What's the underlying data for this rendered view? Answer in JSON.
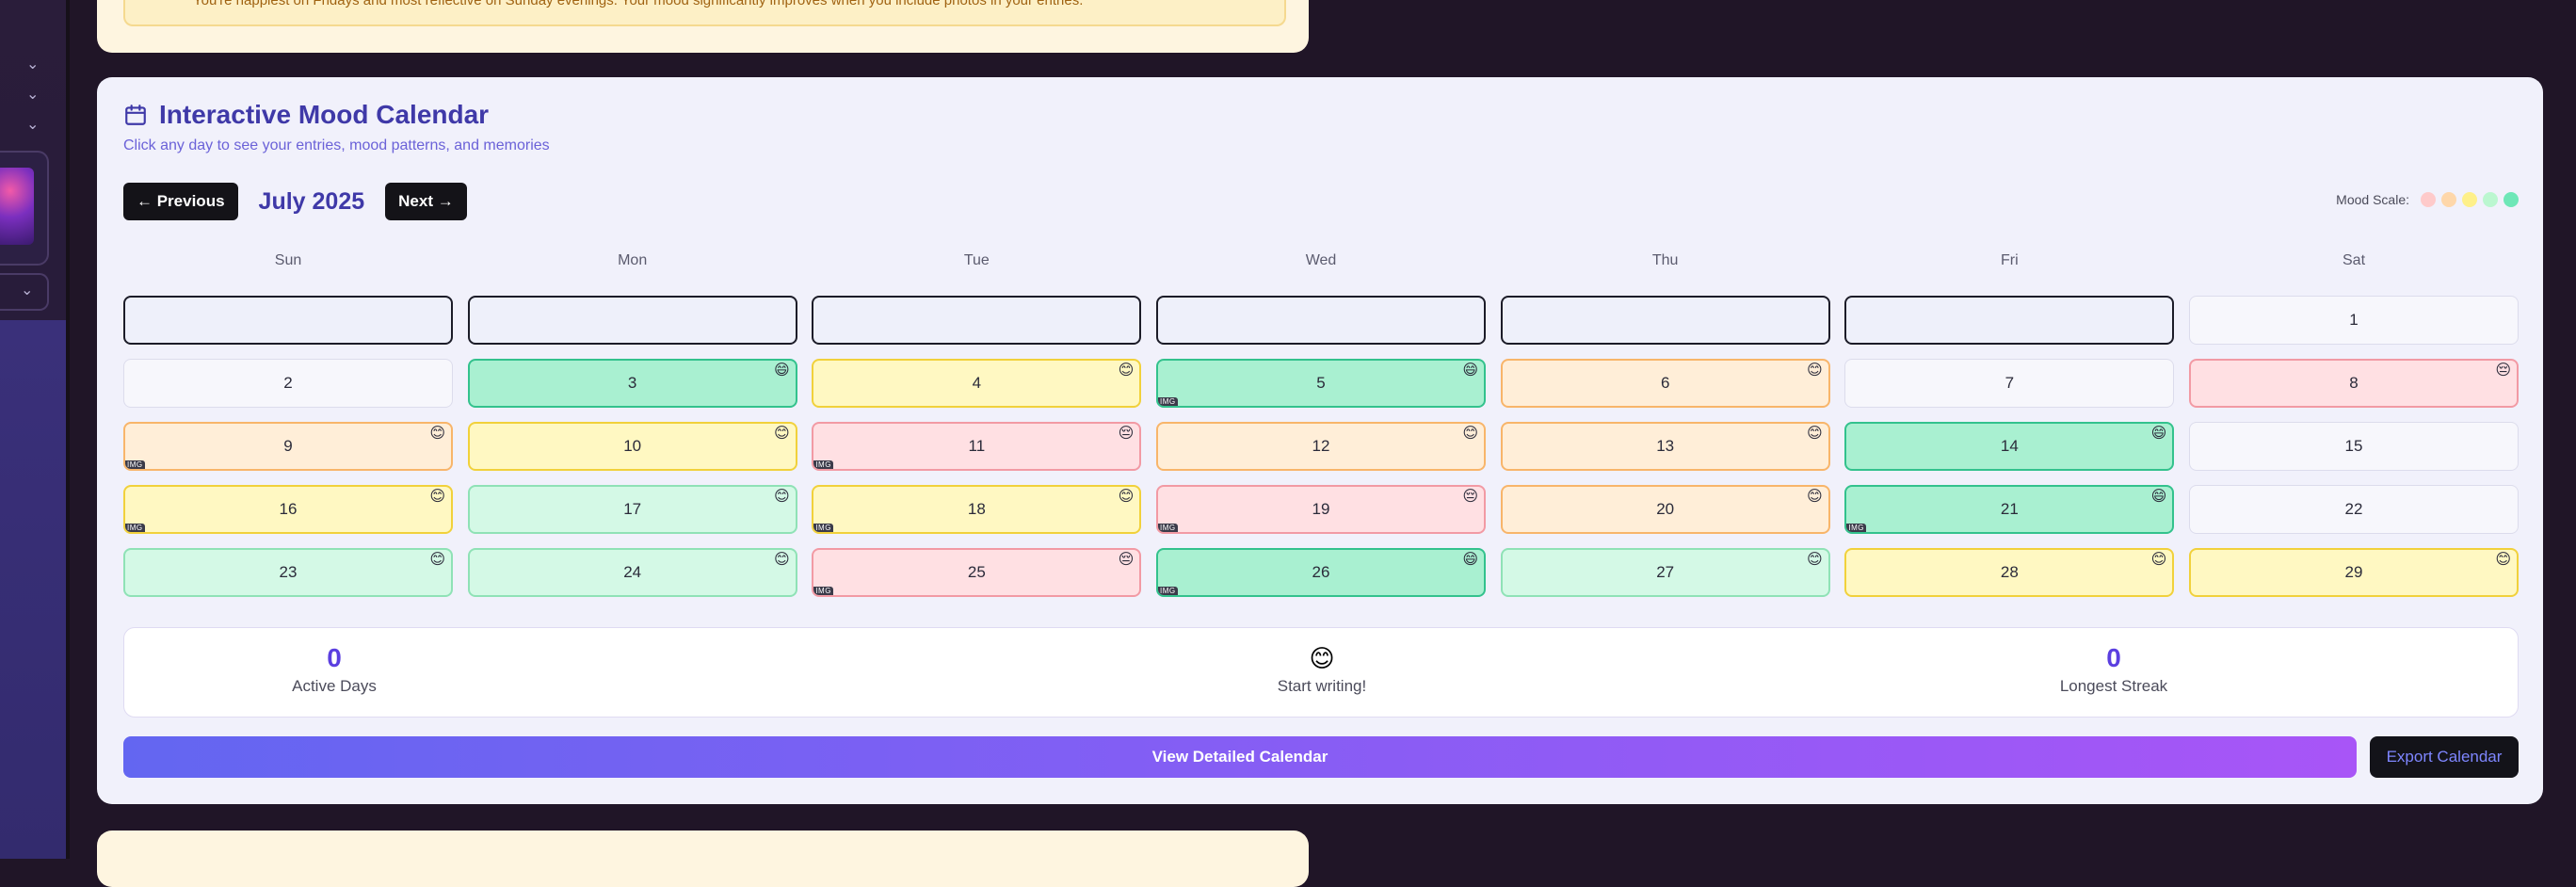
{
  "insights": {
    "text": "You're happiest on Fridays and most reflective on Sunday evenings. Your mood significantly improves when you include photos in your entries."
  },
  "calendar": {
    "title": "Interactive Mood Calendar",
    "subtitle": "Click any day to see your entries, mood patterns, and memories",
    "prev_label": "← Previous",
    "next_label": "Next →",
    "month": "July 2025",
    "mood_scale_label": "Mood Scale:",
    "mood_scale_colors": [
      "#fecaca",
      "#fed7aa",
      "#fef08a",
      "#bbf7d0",
      "#6ee7b7"
    ],
    "weekdays": [
      "Sun",
      "Mon",
      "Tue",
      "Wed",
      "Thu",
      "Fri",
      "Sat"
    ],
    "weeks": [
      [
        {
          "day": "",
          "mood": "empty"
        },
        {
          "day": "",
          "mood": "empty"
        },
        {
          "day": "",
          "mood": "empty"
        },
        {
          "day": "",
          "mood": "empty"
        },
        {
          "day": "",
          "mood": "empty"
        },
        {
          "day": "",
          "mood": "empty"
        },
        {
          "day": "1",
          "mood": "none"
        }
      ],
      [
        {
          "day": "2",
          "mood": "none"
        },
        {
          "day": "3",
          "mood": "green",
          "emoji": "😄"
        },
        {
          "day": "4",
          "mood": "yellow",
          "emoji": "😊"
        },
        {
          "day": "5",
          "mood": "green",
          "emoji": "😄",
          "tag": "IMG"
        },
        {
          "day": "6",
          "mood": "orange",
          "emoji": "😊"
        },
        {
          "day": "7",
          "mood": "none"
        },
        {
          "day": "8",
          "mood": "red",
          "emoji": "😔"
        }
      ],
      [
        {
          "day": "9",
          "mood": "orange",
          "emoji": "😊",
          "tag": "IMG"
        },
        {
          "day": "10",
          "mood": "yellow",
          "emoji": "😊"
        },
        {
          "day": "11",
          "mood": "red",
          "emoji": "😔",
          "tag": "IMG"
        },
        {
          "day": "12",
          "mood": "orange",
          "emoji": "😊"
        },
        {
          "day": "13",
          "mood": "orange",
          "emoji": "😊"
        },
        {
          "day": "14",
          "mood": "green",
          "emoji": "😄"
        },
        {
          "day": "15",
          "mood": "none"
        }
      ],
      [
        {
          "day": "16",
          "mood": "yellow",
          "emoji": "😊",
          "tag": "IMG"
        },
        {
          "day": "17",
          "mood": "lgreen",
          "emoji": "😊"
        },
        {
          "day": "18",
          "mood": "yellow",
          "emoji": "😊",
          "tag": "IMG"
        },
        {
          "day": "19",
          "mood": "red",
          "emoji": "😔",
          "tag": "IMG"
        },
        {
          "day": "20",
          "mood": "orange",
          "emoji": "😊"
        },
        {
          "day": "21",
          "mood": "green",
          "emoji": "😄",
          "tag": "IMG"
        },
        {
          "day": "22",
          "mood": "none"
        }
      ],
      [
        {
          "day": "23",
          "mood": "lgreen",
          "emoji": "😊"
        },
        {
          "day": "24",
          "mood": "lgreen",
          "emoji": "😊"
        },
        {
          "day": "25",
          "mood": "red",
          "emoji": "😔",
          "tag": "IMG"
        },
        {
          "day": "26",
          "mood": "green",
          "emoji": "😄",
          "tag": "IMG"
        },
        {
          "day": "27",
          "mood": "lgreen",
          "emoji": "😊"
        },
        {
          "day": "28",
          "mood": "yellow",
          "emoji": "😊"
        },
        {
          "day": "29",
          "mood": "yellow",
          "emoji": "😊"
        }
      ]
    ]
  },
  "stats": {
    "active_days": "0",
    "active_days_label": "Active Days",
    "mood_emoji": "😊",
    "mood_label": "Start writing!",
    "longest_streak": "0",
    "longest_streak_label": "Longest Streak"
  },
  "actions": {
    "detailed_label": "View Detailed Calendar",
    "export_label": "Export Calendar"
  },
  "colors": {
    "accent": "#3f39a8",
    "brand_gradient_start": "#6366f1",
    "brand_gradient_end": "#a855f7"
  }
}
